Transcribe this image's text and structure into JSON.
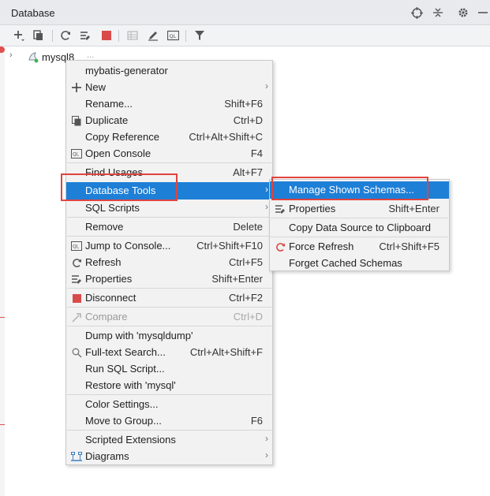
{
  "window": {
    "title": "Database"
  },
  "tree": {
    "connection_name": "mysql8",
    "more": "..."
  },
  "context_menu": {
    "items": [
      {
        "label": "mybatis-generator"
      },
      {
        "label": "New"
      },
      {
        "label": "Rename...",
        "shortcut": "Shift+F6"
      },
      {
        "label": "Duplicate",
        "shortcut": "Ctrl+D"
      },
      {
        "label": "Copy Reference",
        "shortcut": "Ctrl+Alt+Shift+C"
      },
      {
        "label": "Open Console",
        "shortcut": "F4"
      },
      {
        "label": "Find Usages",
        "shortcut": "Alt+F7"
      },
      {
        "label": "Database Tools"
      },
      {
        "label": "SQL Scripts"
      },
      {
        "label": "Remove",
        "shortcut": "Delete"
      },
      {
        "label": "Jump to Console...",
        "shortcut": "Ctrl+Shift+F10"
      },
      {
        "label": "Refresh",
        "shortcut": "Ctrl+F5"
      },
      {
        "label": "Properties",
        "shortcut": "Shift+Enter"
      },
      {
        "label": "Disconnect",
        "shortcut": "Ctrl+F2"
      },
      {
        "label": "Compare",
        "shortcut": "Ctrl+D"
      },
      {
        "label": "Dump with 'mysqldump'"
      },
      {
        "label": "Full-text Search...",
        "shortcut": "Ctrl+Alt+Shift+F"
      },
      {
        "label": "Run SQL Script..."
      },
      {
        "label": "Restore with 'mysql'"
      },
      {
        "label": "Color Settings..."
      },
      {
        "label": "Move to Group...",
        "shortcut": "F6"
      },
      {
        "label": "Scripted Extensions"
      },
      {
        "label": "Diagrams"
      }
    ]
  },
  "submenu": {
    "items": [
      {
        "label": "Manage Shown Schemas..."
      },
      {
        "label": "Properties",
        "shortcut": "Shift+Enter"
      },
      {
        "label": "Copy Data Source to Clipboard"
      },
      {
        "label": "Force Refresh",
        "shortcut": "Ctrl+Shift+F5"
      },
      {
        "label": "Forget Cached Schemas"
      }
    ]
  },
  "colors": {
    "selection": "#1e7fd6",
    "highlight_box": "#e0443e"
  }
}
